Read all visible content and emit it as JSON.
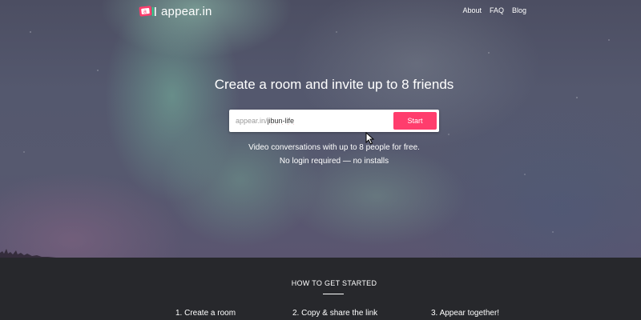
{
  "brand": {
    "name": "appear.in",
    "logo_icon": "appear-in-logo-icon",
    "accent_color": "#ff3d6d"
  },
  "nav": {
    "items": [
      {
        "label": "About"
      },
      {
        "label": "FAQ"
      },
      {
        "label": "Blog"
      }
    ]
  },
  "hero": {
    "headline": "Create a room and invite up to 8 friends",
    "url_prefix": "appear.in/",
    "room_value": "jibun-life",
    "start_label": "Start",
    "subtext_1": "Video conversations with up to 8 people for free.",
    "subtext_2": "No login required — no installs"
  },
  "how_to": {
    "title": "HOW TO GET STARTED",
    "steps": [
      {
        "label": "1. Create a room"
      },
      {
        "label": "2. Copy & share the link"
      },
      {
        "label": "3. Appear together!"
      }
    ]
  }
}
